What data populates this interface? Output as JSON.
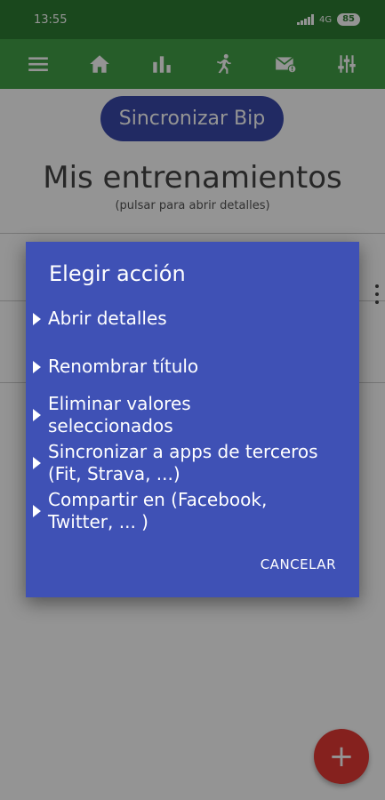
{
  "statusbar": {
    "time": "13:55",
    "network": "4G",
    "battery": "85"
  },
  "toolbar": {
    "icons": [
      "menu-icon",
      "home-icon",
      "bar-chart-icon",
      "running-icon",
      "mail-badge-icon",
      "sliders-icon"
    ]
  },
  "main": {
    "sync_button": "Sincronizar Bip",
    "title": "Mis entrenamientos",
    "subtitle": "(pulsar para abrir detalles)"
  },
  "dialog": {
    "title": "Elegir acción",
    "options": [
      "Abrir detalles",
      "Renombrar título",
      "Eliminar valores\nseleccionados",
      "Sincronizar a apps de terceros\n(Fit, Strava, ...)",
      "Compartir en (Facebook,\nTwitter, ... )"
    ],
    "cancel": "CANCELAR"
  },
  "fab": {
    "label": "+"
  },
  "colors": {
    "statusbar": "#2e7d32",
    "toolbar": "#43a047",
    "dialog": "#3f51b5",
    "sync_button": "#3949ab",
    "fab": "#e53935"
  }
}
